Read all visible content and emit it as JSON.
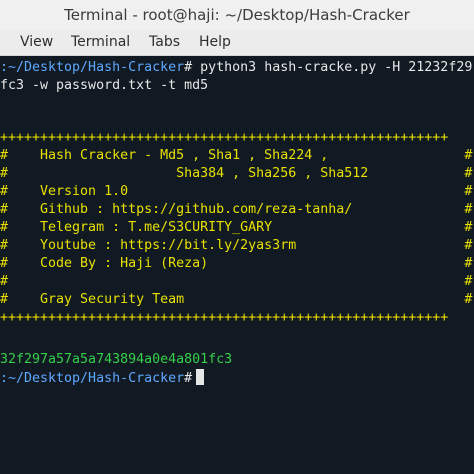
{
  "window": {
    "title": "Terminal - root@haji: ~/Desktop/Hash-Cracker"
  },
  "menu": [
    "View",
    "Terminal",
    "Tabs",
    "Help"
  ],
  "terminal": {
    "cmd_path": ":~/Desktop/Hash-Cracker",
    "cmd_hash": "#",
    "cmd_text": " python3 hash-cracke.py -H 21232f29",
    "cmd_wrap": "fc3 -w password.txt -t md5",
    "border": "++++++++++++++++++++++++++++++++++++++++++++++++++++++++",
    "banner": [
      "#    Hash Cracker - Md5 , Sha1 , Sha224 ,                 #",
      "#                     Sha384 , Sha256 , Sha512            #",
      "#    Version 1.0                                          #",
      "#    Github : https://github.com/reza-tanha/              #",
      "#    Telegram : T.me/S3CURITY_GARY                        #",
      "#    Youtube : https://bit.ly/2yas3rm                     #",
      "#    Code By : Haji (Reza)                                #",
      "#                                                         #",
      "#    Gray Security Team                                   #"
    ],
    "result": "32f297a57a5a743894a0e4a801fc3",
    "prompt_path": ":~/Desktop/Hash-Cracker",
    "prompt_hash": "#"
  }
}
